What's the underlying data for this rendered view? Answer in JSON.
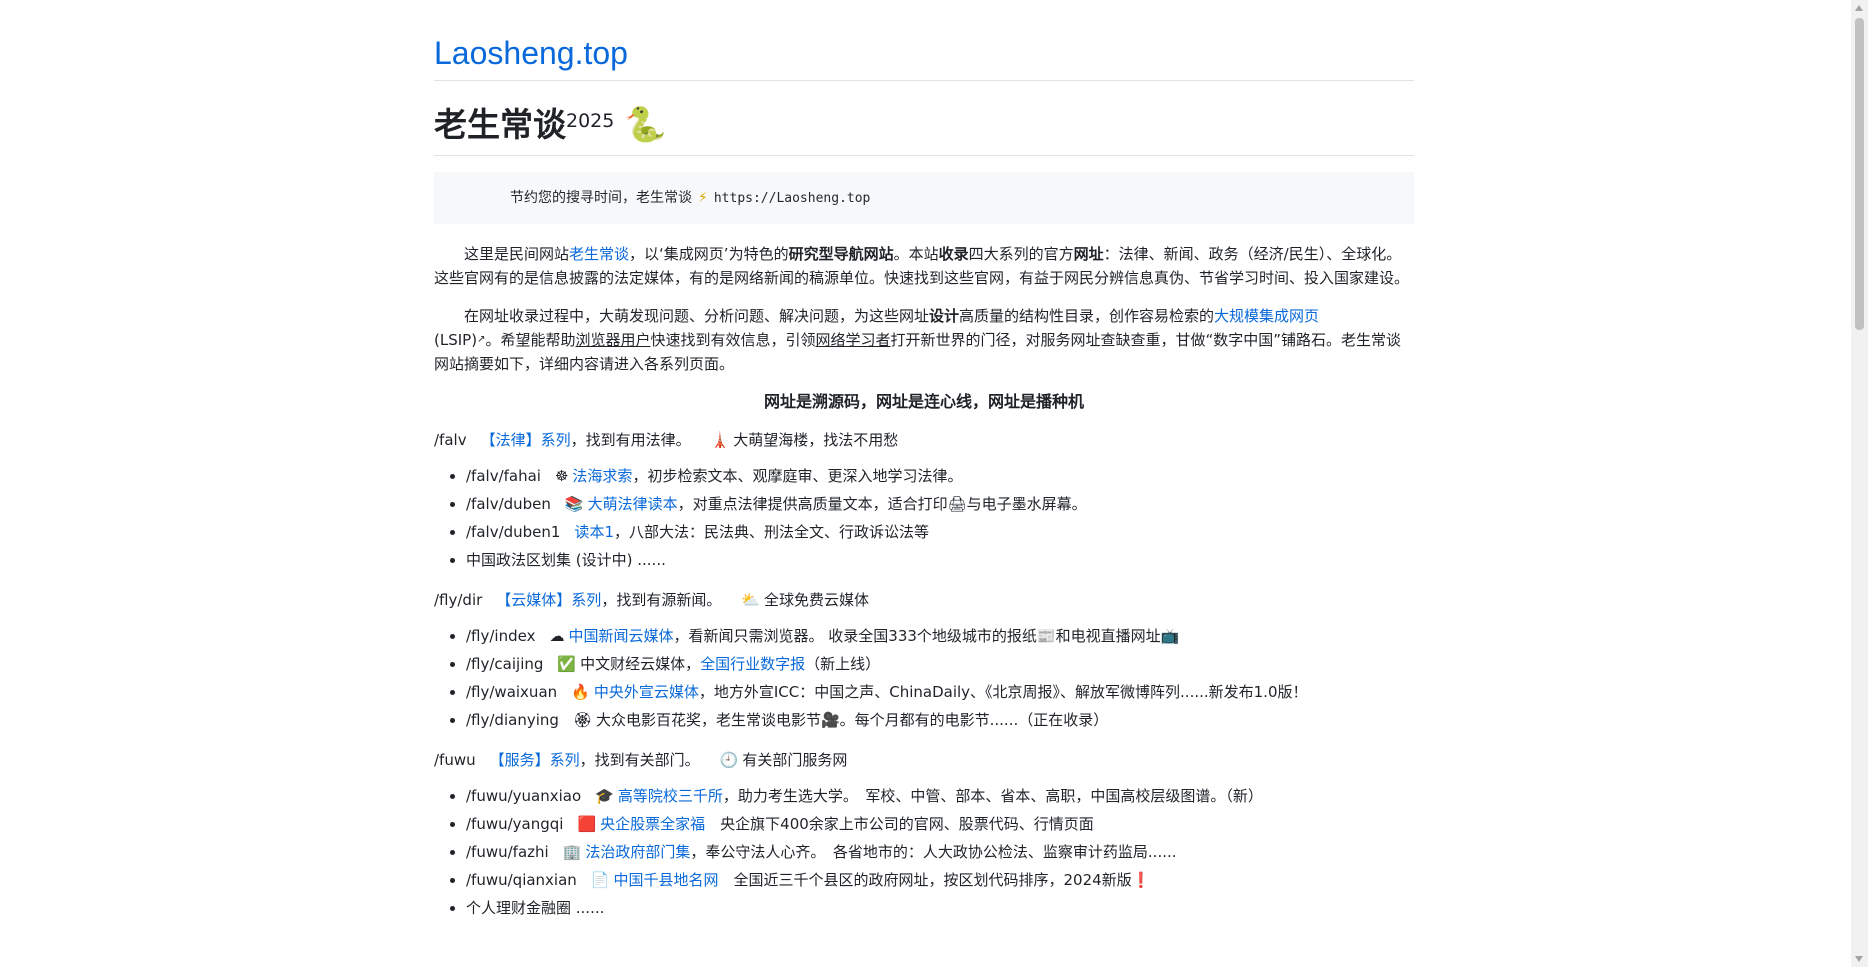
{
  "site": {
    "title": "Laosheng.top"
  },
  "header": {
    "title": "老生常谈",
    "year": "2025",
    "emoji": "🐍"
  },
  "tagline": {
    "text": "节约您的搜寻时间，老生常谈",
    "icon": "⚡",
    "url": "https://Laosheng.top"
  },
  "intro": {
    "p1_a": "这里是民间网站",
    "p1_link": "老生常谈",
    "p1_b": "，以‘集成网页’为特色的",
    "p1_bold1": "研究型导航网站",
    "p1_c": "。本站",
    "p1_bold2": "收录",
    "p1_d": "四大系列的官方",
    "p1_bold3": "网址",
    "p1_e": "：法律、新闻、政务（经济/民生）、全球化。这些官网有的是信息披露的法定媒体，有的是网络新闻的稿源单位。快速找到这些官网，有益于网民分辨信息真伪、节省学习时间、投入国家建设。",
    "p2_a": "在网址收录过程中，大萌发现问题、分析问题、解决问题，为这些网址",
    "p2_bold": "设计",
    "p2_b": "高质量的结构性目录，创作容易检索的",
    "p2_link": "大规模集成网页",
    "p2_c": "(LSIP)",
    "p2_d": "。希望能帮助",
    "p2_u1": "浏览器用户",
    "p2_e": "快速找到有效信息，引领",
    "p2_u2": "网络学习者",
    "p2_f": "打开新世界的门径，对服务网址查缺查重，甘做“数字中国”铺路石。老生常谈网站摘要如下，详细内容请进入各系列页面。",
    "motto": "网址是溯源码，网址是连心线，网址是播种机"
  },
  "sections": [
    {
      "path": "/falv",
      "link": "【法律】系列",
      "desc": "，找到有用法律。",
      "icon": "🗼",
      "tag": "大萌望海楼，找法不用愁",
      "items": [
        {
          "path": "/falv/fahai",
          "icon": "☸",
          "link": "法海求索",
          "desc": "，初步检索文本、观摩庭审、更深入地学习法律。"
        },
        {
          "path": "/falv/duben",
          "icon": "📚",
          "link": "大萌法律读本",
          "desc": "，对重点法律提供高质量文本，适合打印🖨与电子墨水屏幕。"
        },
        {
          "path": "/falv/duben1",
          "icon": "",
          "link": "读本1",
          "desc": "，八部大法：民法典、刑法全文、行政诉讼法等"
        },
        {
          "path": "",
          "icon": "",
          "link": "",
          "desc": "中国政法区划集 (设计中) ......"
        }
      ]
    },
    {
      "path": "/fly/dir",
      "link": "【云媒体】系列",
      "desc": "，找到有源新闻。",
      "icon": "⛅",
      "tag": "全球免费云媒体",
      "items": [
        {
          "path": "/fly/index",
          "icon": "☁",
          "link": "中国新闻云媒体",
          "desc": "，看新闻只需浏览器。 收录全国333个地级城市的报纸📰和电视直播网址📺"
        },
        {
          "path": "/fly/caijing",
          "icon": "✅",
          "link": "",
          "desc": "中文财经云媒体，",
          "link2": "全国行业数字报",
          "desc2": "（新上线）"
        },
        {
          "path": "/fly/waixuan",
          "icon": "🔥",
          "link": "中央外宣云媒体",
          "desc": "，地方外宣ICC：中国之声、ChinaDaily、《北京周报》、解放军微博阵列......新发布1.0版！"
        },
        {
          "path": "/fly/dianying",
          "icon": "🏵",
          "link": "",
          "desc": "大众电影百花奖，老生常谈电影节🎥。每个月都有的电影节......（正在收录）"
        }
      ]
    },
    {
      "path": "/fuwu",
      "link": "【服务】系列",
      "desc": "，找到有关部门。",
      "icon": "🕘",
      "tag": "有关部门服务网",
      "items": [
        {
          "path": "/fuwu/yuanxiao",
          "icon": "🎓",
          "link": "高等院校三千所",
          "desc": "，助力考生选大学。　军校、中管、部本、省本、高职，中国高校层级图谱。（新）"
        },
        {
          "path": "/fuwu/yangqi",
          "icon": "🟥",
          "link": "央企股票全家福",
          "desc": "　央企旗下400余家上市公司的官网、股票代码、行情页面"
        },
        {
          "path": "/fuwu/fazhi",
          "icon": "🏢",
          "link": "法治政府部门集",
          "desc": "，奉公守法人心齐。　各省地市的：人大政协公检法、监察审计药监局......"
        },
        {
          "path": "/fuwu/qianxian",
          "icon": "📄",
          "link": "中国千县地名网",
          "desc": "　全国近三千个县区的政府网址，按区划代码排序，2024新版❗"
        },
        {
          "path": "",
          "icon": "",
          "link": "",
          "desc": "个人理财金融圈 ......"
        }
      ]
    }
  ],
  "colors": {
    "link": "#0969da",
    "text": "#1f2328",
    "quote_bg": "#f6f8fa"
  }
}
